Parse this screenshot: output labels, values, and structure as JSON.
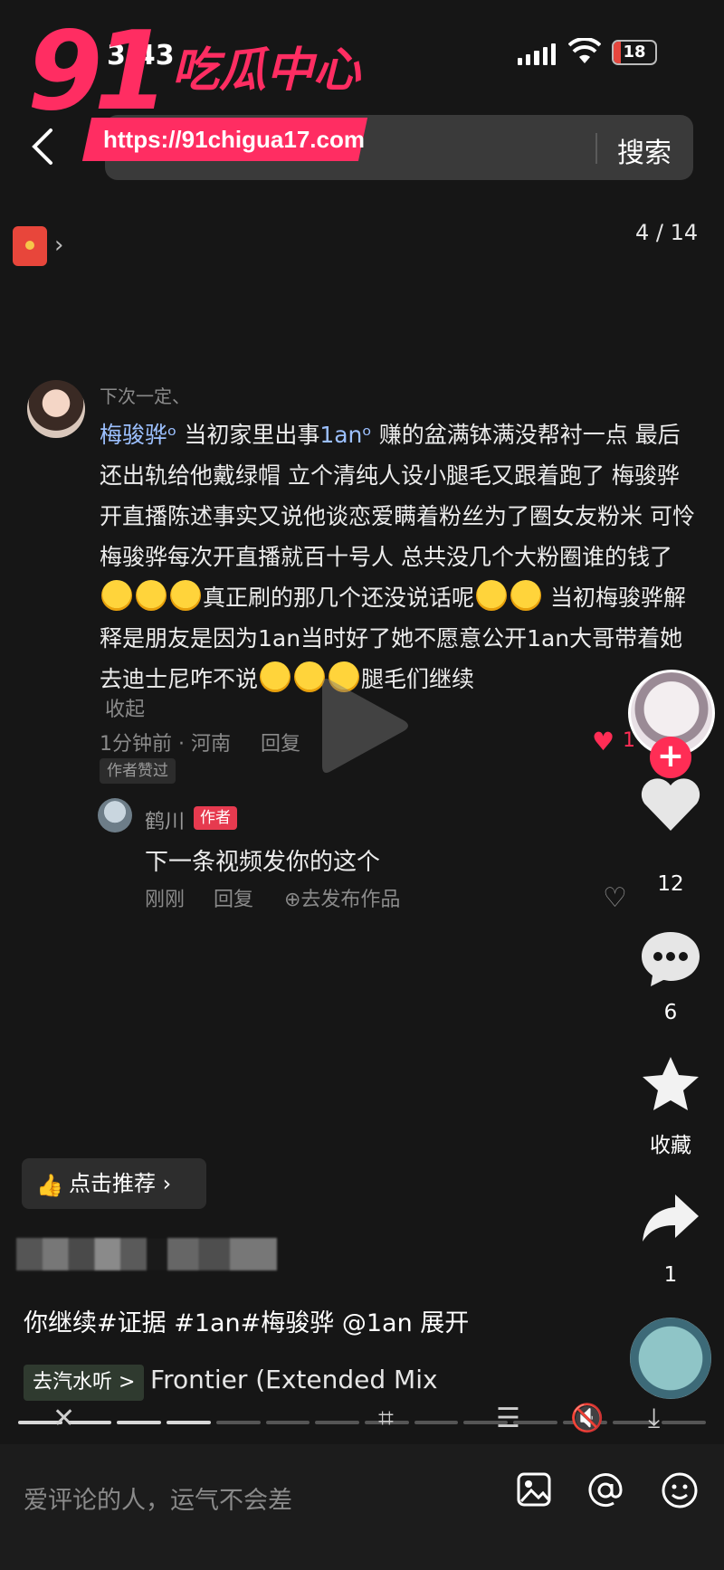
{
  "status_bar": {
    "time": "3:43",
    "battery": "18",
    "battery_level": 0.18
  },
  "watermark": {
    "brand_number": "91",
    "brand_text": "吃瓜中心",
    "url": "https://91chigua17.com"
  },
  "top_bar": {
    "search_button": "搜索"
  },
  "page_counter": "4 / 14",
  "comment": {
    "user": "下次一定、",
    "mention_1": "梅骏骅",
    "text_1": "当初家里出事",
    "mention_2": "1an",
    "text_2": "赚的盆满钵满没帮衬一点 最后还出轨给他戴绿帽 立个清纯人设小腿毛又跟着跑了 梅骏骅开直播陈述事实又说他谈恋爱瞒着粉丝为了圈女友粉米 可怜梅骏骅每次开直播就百十号人 总共没几个大粉圈谁的钱了",
    "text_3": "真正刷的那几个还没说话呢",
    "text_4": "当初梅骏骅解释是朋友是因为1an当时好了她不愿意公开1an大哥带着她去迪士尼咋不说",
    "text_5": "腿毛们继续",
    "collapse": "收起",
    "meta": "1分钟前 · 河南",
    "reply": "回复",
    "author_liked": "作者赞过",
    "likes": "1"
  },
  "author_reply": {
    "name": "鹤川",
    "tag": "作者",
    "text": "下一条视频发你的这个",
    "time": "刚刚",
    "reply": "回复",
    "publish": "⊕去发布作品"
  },
  "rail": {
    "likes": "12",
    "comments": "6",
    "favorite": "收藏",
    "shares": "1"
  },
  "video_info": {
    "recommend": "点击推荐",
    "caption": "你继续#证据 #1an#梅骏骅 @1an  展开",
    "music_tag": "去汽水听 >",
    "music_title": "Frontier (Extended Mix"
  },
  "comment_input": {
    "placeholder": "爱评论的人，运气不会差"
  },
  "colors": {
    "accent": "#ff2d55",
    "watermark": "#ff2d62",
    "background": "#161616"
  }
}
